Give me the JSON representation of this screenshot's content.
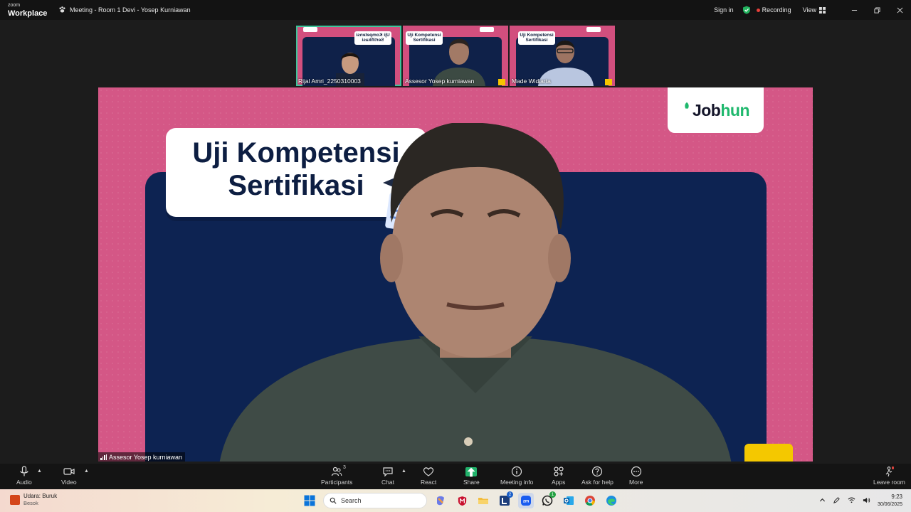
{
  "app": {
    "brand_small": "zoom",
    "brand_large": "Workplace",
    "meeting_title": "Meeting - Room 1 Devi - Yosep Kurniawan",
    "sign_in": "Sign in",
    "recording": "Recording",
    "view": "View"
  },
  "thumbnails": [
    {
      "name": "Rijal Amri_2250310003",
      "card": "Uji Kompetensi Sertifikasi",
      "active": true
    },
    {
      "name": "Assesor Yosep kurniawan",
      "card": "Uji Kompetensi Sertifikasi",
      "active": false
    },
    {
      "name": "Made Widiarta",
      "card": "Uji Kompetensi Sertifikasi",
      "active": false
    }
  ],
  "main": {
    "slide_line1": "Uji Kompetensi",
    "slide_line2": "Sertifikasi",
    "logo_part1": "Job",
    "logo_part2": "hun",
    "speaker_name": "Assesor Yosep kurniawan"
  },
  "toolbar": {
    "audio": "Audio",
    "video": "Video",
    "participants": "Participants",
    "participants_count": "3",
    "chat": "Chat",
    "react": "React",
    "share": "Share",
    "meeting_info": "Meeting info",
    "apps": "Apps",
    "ask_help": "Ask for help",
    "more": "More",
    "leave": "Leave room"
  },
  "taskbar": {
    "weather_line1": "Udara: Buruk",
    "weather_line2": "Besok",
    "search": "Search",
    "time": "9:23",
    "date": "30/06/2025",
    "badge_l": "2",
    "badge_wa": "1"
  },
  "colors": {
    "accent_green": "#21b26b",
    "slide_pink": "#d45786",
    "slide_navy": "#0d2352",
    "recording_red": "#e8403a"
  }
}
